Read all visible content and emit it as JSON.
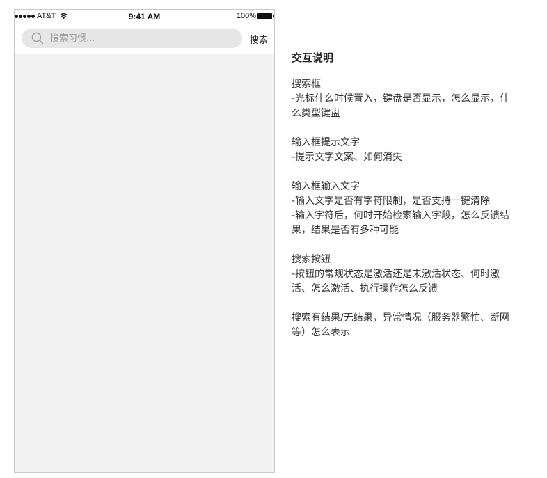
{
  "status_bar": {
    "carrier": "AT&T",
    "time": "9:41 AM",
    "battery": "100%"
  },
  "search": {
    "placeholder": "搜索习惯...",
    "button_label": "搜索"
  },
  "notes": {
    "title": "交互说明",
    "sections": [
      {
        "lines": [
          "搜索框",
          "-光标什么时候置入，键盘是否显示，怎么显示，什么类型键盘"
        ]
      },
      {
        "lines": [
          "输入框提示文字",
          "-提示文字文案、如何消失"
        ]
      },
      {
        "lines": [
          "输入框输入文字",
          "-输入文字是否有字符限制，是否支持一键清除",
          "-输入字符后，何时开始检索输入字段，怎么反馈结果，结果是否有多种可能"
        ]
      },
      {
        "lines": [
          "搜索按钮",
          "-按钮的常规状态是激活还是未激活状态、何时激活、怎么激活、执行操作怎么反馈"
        ]
      },
      {
        "lines": [
          "搜索有结果/无结果，异常情况（服务器繁忙、断网等）怎么表示"
        ]
      }
    ]
  }
}
